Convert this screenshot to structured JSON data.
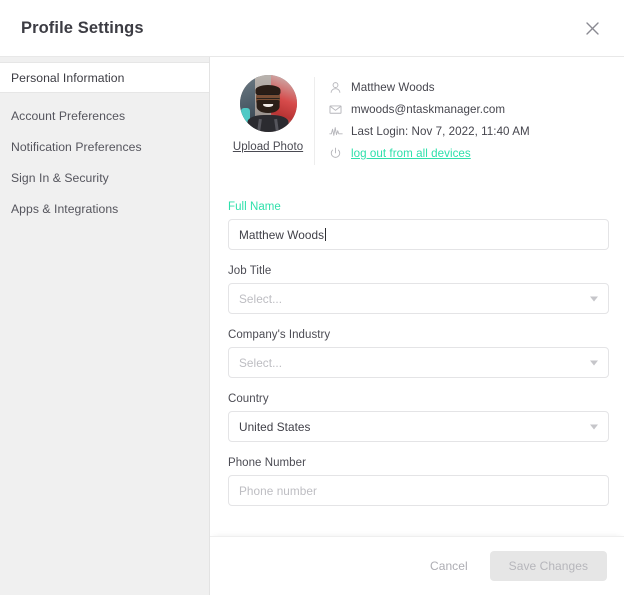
{
  "header": {
    "title": "Profile Settings",
    "close_icon": "close-icon"
  },
  "sidebar": {
    "items": [
      {
        "label": "Personal Information",
        "active": true
      },
      {
        "label": "Account Preferences",
        "active": false
      },
      {
        "label": "Notification Preferences",
        "active": false
      },
      {
        "label": "Sign In & Security",
        "active": false
      },
      {
        "label": "Apps & Integrations",
        "active": false
      }
    ]
  },
  "profile": {
    "avatar_alt": "user-avatar-photo",
    "upload_label": "Upload Photo",
    "rows": [
      {
        "icon": "user-icon",
        "text": "Matthew Woods",
        "link": false
      },
      {
        "icon": "mail-icon",
        "text": "mwoods@ntaskmanager.com",
        "link": false
      },
      {
        "icon": "activity-icon",
        "text": "Last Login: Nov 7, 2022, 11:40 AM",
        "link": false
      },
      {
        "icon": "power-icon",
        "text": "log out from all devices",
        "link": true
      }
    ]
  },
  "form": {
    "full_name": {
      "label": "Full Name",
      "value": "Matthew Woods",
      "focused": true
    },
    "job_title": {
      "label": "Job Title",
      "value": "Select...",
      "is_placeholder": true
    },
    "company_industry": {
      "label": "Company's Industry",
      "value": "Select...",
      "is_placeholder": true
    },
    "country": {
      "label": "Country",
      "value": "United States",
      "is_placeholder": false
    },
    "phone_number": {
      "label": "Phone Number",
      "value": "",
      "placeholder": "Phone number"
    }
  },
  "footer": {
    "cancel_label": "Cancel",
    "save_label": "Save Changes"
  },
  "colors": {
    "accent": "#2fe0ab",
    "sidebar_bg": "#f0f0f0",
    "text": "#46464e",
    "border": "#e4e4e6"
  }
}
